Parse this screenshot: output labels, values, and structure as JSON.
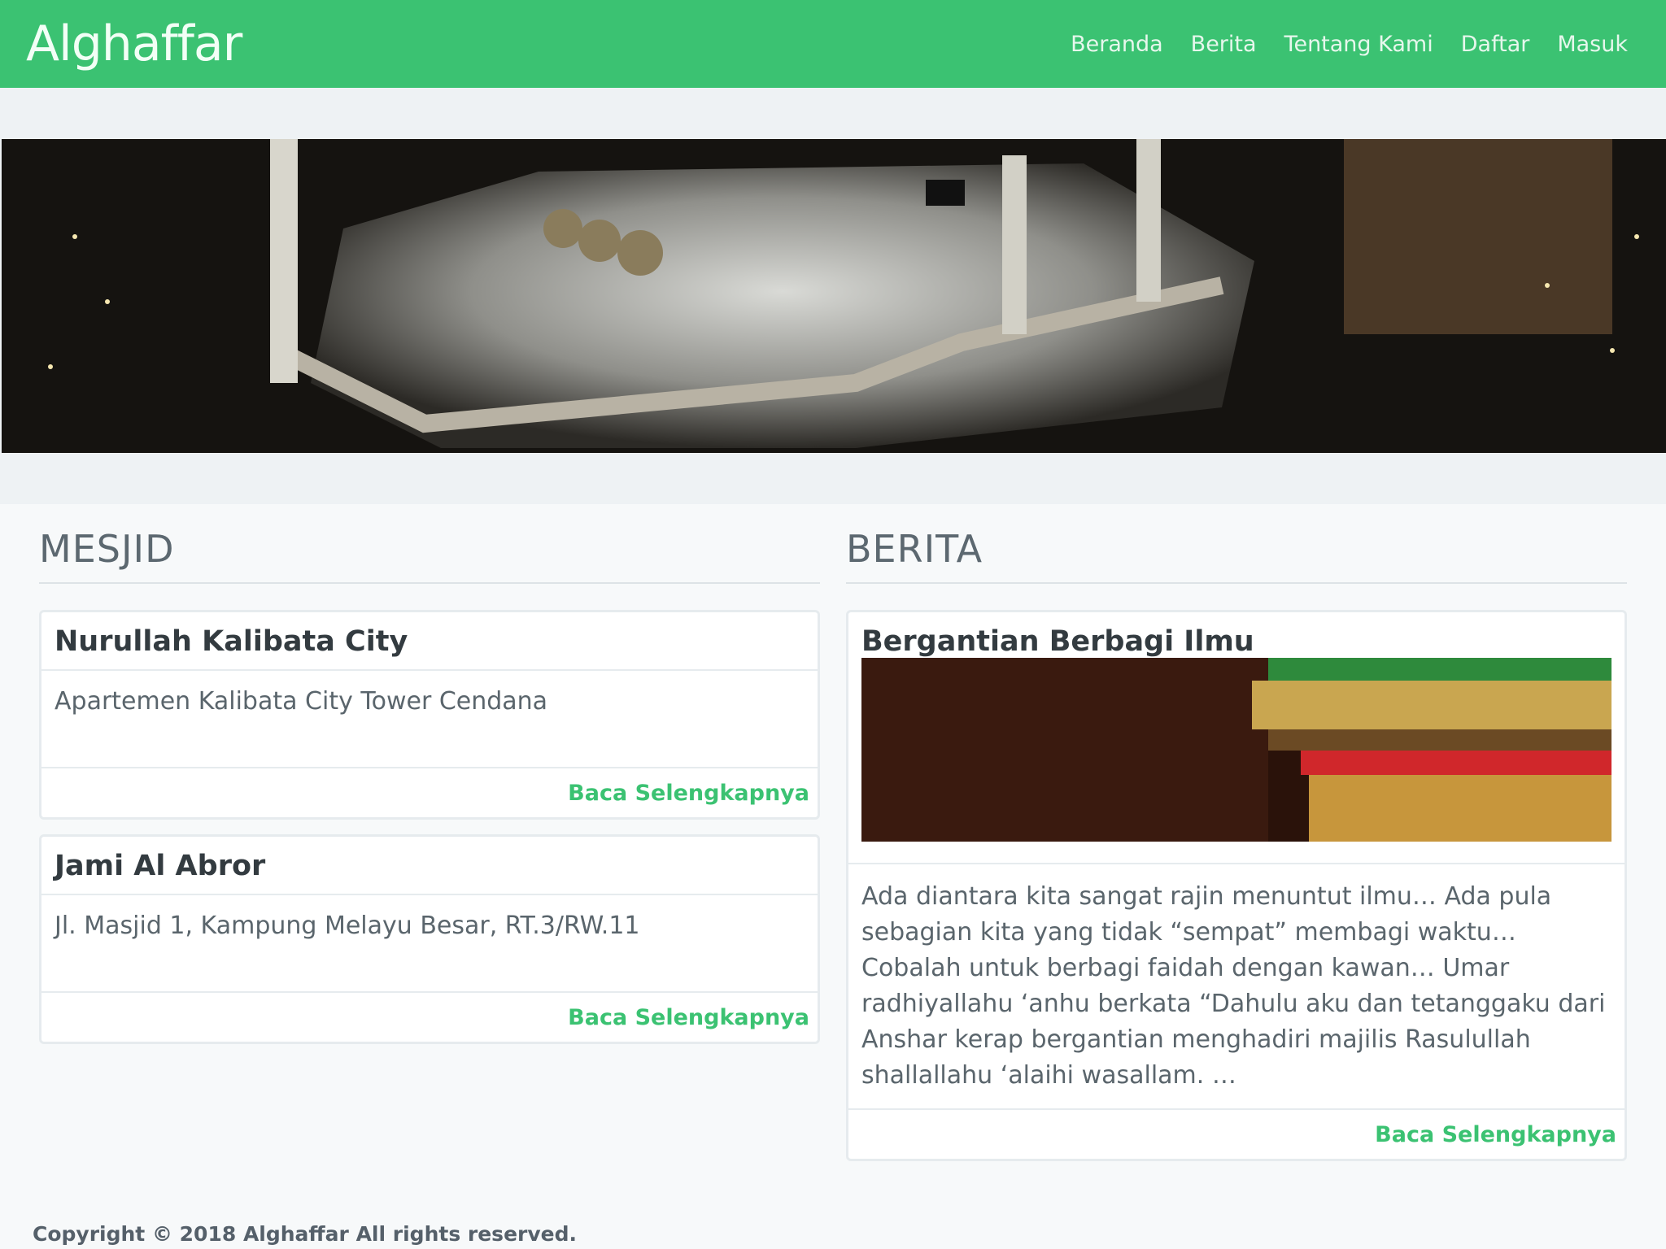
{
  "brand": "Alghaffar",
  "nav": {
    "items": [
      "Beranda",
      "Berita",
      "Tentang Kami",
      "Daftar",
      "Masuk"
    ]
  },
  "hero": {
    "image": "masjidil-haram-night-image"
  },
  "mesjid": {
    "title": "MESJID",
    "cards": [
      {
        "name": "Nurullah Kalibata City",
        "address": "Apartemen Kalibata City Tower Cendana",
        "link": "Baca Selengkapnya"
      },
      {
        "name": "Jami Al Abror",
        "address": "Jl. Masjid 1, Kampung Melayu Besar, RT.3/RW.11",
        "link": "Baca Selengkapnya"
      }
    ]
  },
  "berita": {
    "title": "BERITA",
    "card": {
      "headline": "Bergantian Berbagi Ilmu",
      "image": "books-stack-image",
      "excerpt": "Ada diantara kita sangat rajin menuntut ilmu… Ada pula sebagian kita yang tidak “sempat” membagi waktu… Cobalah untuk berbagi faidah dengan kawan… Umar radhiyallahu ‘anhu berkata “Dahulu aku dan tetanggaku dari Anshar kerap bergantian menghadiri majilis Rasulullah shallallahu ‘alaihi wasallam. …",
      "link": "Baca Selengkapnya"
    }
  },
  "footer": {
    "copyright": "Copyright © 2018 Alghaffar All rights reserved."
  },
  "colors": {
    "accent": "#3bc272",
    "background": "#f7f9fa"
  }
}
